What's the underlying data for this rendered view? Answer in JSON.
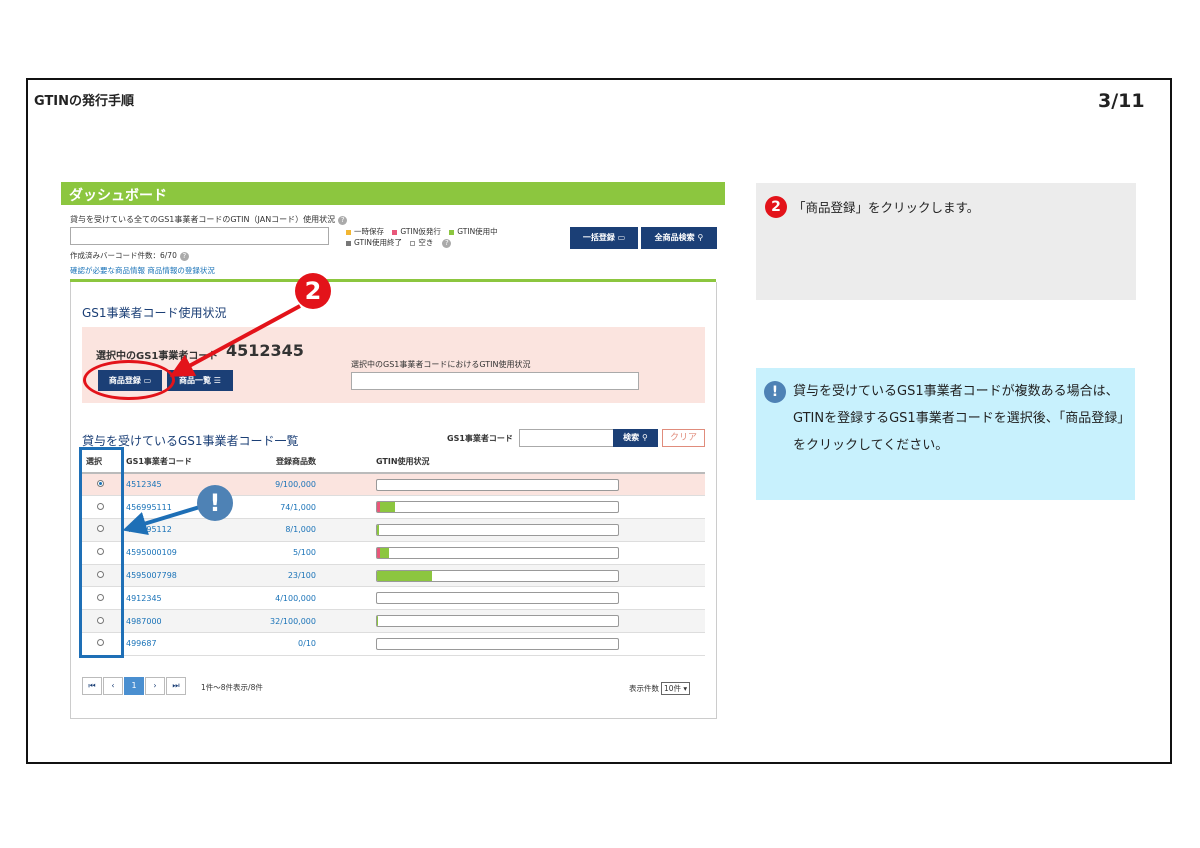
{
  "doc": {
    "title": "GTINの発行手順",
    "page": "3/11"
  },
  "dashboard": {
    "header": "ダッシュボード",
    "usage_caption": "貸与を受けている全てのGS1事業者コードのGTIN（JANコード）使用状況",
    "legend": [
      "一時保存",
      "GTIN仮発行",
      "GTIN使用中",
      "GTIN使用終了",
      "空き"
    ],
    "bulk_button": "一括登録",
    "search_all_button": "全商品検索",
    "barcode_count": "作成済みバーコード件数：6/70",
    "links": "確認が必要な商品情報 商品情報の登録状況"
  },
  "usage_panel": {
    "title": "GS1事業者コード使用状況",
    "selected_label": "選択中のGS1事業者コード",
    "selected_code": "4512345",
    "register_button": "商品登録",
    "list_button": "商品一覧",
    "usage_label": "選択中のGS1事業者コードにおけるGTIN使用状況"
  },
  "code_list": {
    "title": "貸与を受けているGS1事業者コード一覧",
    "search_label": "GS1事業者コード",
    "search_button": "検索",
    "clear_button": "クリア",
    "columns": [
      "選択",
      "GS1事業者コード",
      "登録商品数",
      "GTIN使用状況"
    ],
    "rows": [
      {
        "code": "4512345",
        "count": "9/100,000",
        "usage_pct": 0,
        "pink": false,
        "selected": true
      },
      {
        "code": "456995111",
        "count": "74/1,000",
        "usage_pct": 7.4,
        "pink": true,
        "selected": false
      },
      {
        "code": "456995112",
        "count": "8/1,000",
        "usage_pct": 0.8,
        "pink": false,
        "selected": false
      },
      {
        "code": "4595000109",
        "count": "5/100",
        "usage_pct": 5,
        "pink": true,
        "selected": false
      },
      {
        "code": "4595007798",
        "count": "23/100",
        "usage_pct": 23,
        "pink": false,
        "selected": false
      },
      {
        "code": "4912345",
        "count": "4/100,000",
        "usage_pct": 0,
        "pink": false,
        "selected": false
      },
      {
        "code": "4987000",
        "count": "32/100,000",
        "usage_pct": 0.3,
        "pink": false,
        "selected": false
      },
      {
        "code": "499687",
        "count": "0/10",
        "usage_pct": 0,
        "pink": false,
        "selected": false
      }
    ],
    "pager": [
      "⏮",
      "‹",
      "1",
      "›",
      "⏭"
    ],
    "pager_info": "1件～8件表示/8件",
    "per_page_label": "表示件数",
    "per_page_value": "10件 ▾"
  },
  "callouts": {
    "step_badge": "2",
    "step_text": "「商品登録」をクリックします。",
    "info_badge": "!",
    "info_text": "貸与を受けているGS1事業者コードが複数ある場合は、GTINを登録するGS1事業者コードを選択後、「商品登録」をクリックしてください。"
  },
  "colors": {
    "brand_green": "#8cc63f",
    "navy": "#1b3f76",
    "highlight_red": "#e3131a",
    "highlight_blue": "#1e6fb6"
  }
}
